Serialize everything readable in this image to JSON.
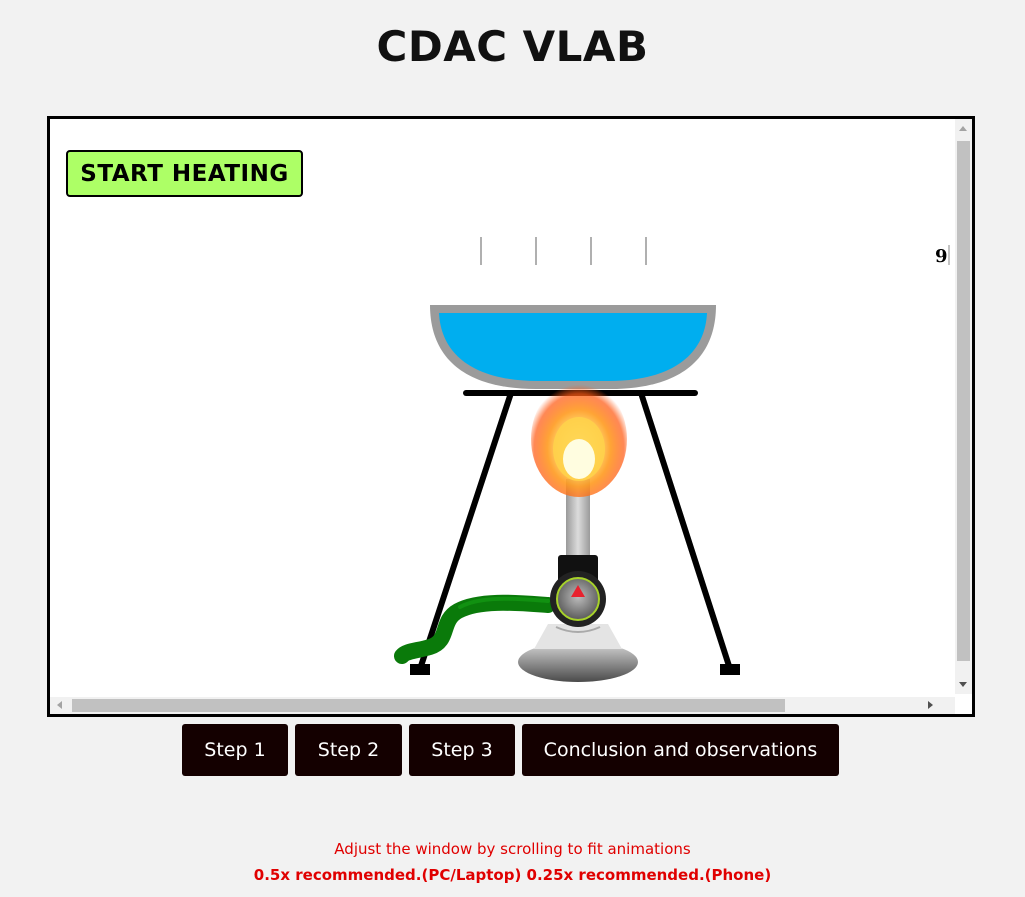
{
  "header": {
    "title": "CDAC VLAB"
  },
  "simulation": {
    "start_button_label": "START HEATING",
    "counter_value": "9",
    "burner_valve_state": "open",
    "flame_lit": true,
    "colors": {
      "water": "#00aeef",
      "bowl": "#9b9b9b",
      "tripod": "#000000",
      "gas_tube": "#0a7a0a",
      "start_button": "#adff66"
    }
  },
  "steps": {
    "items": [
      {
        "label": "Step 1"
      },
      {
        "label": "Step 2"
      },
      {
        "label": "Step 3"
      },
      {
        "label": "Conclusion and observations"
      }
    ],
    "button_color": "#140000"
  },
  "notices": {
    "scroll_hint": "Adjust the window by scrolling to fit animations",
    "zoom_hint": "0.5x recommended.(PC/Laptop) 0.25x recommended.(Phone)"
  }
}
